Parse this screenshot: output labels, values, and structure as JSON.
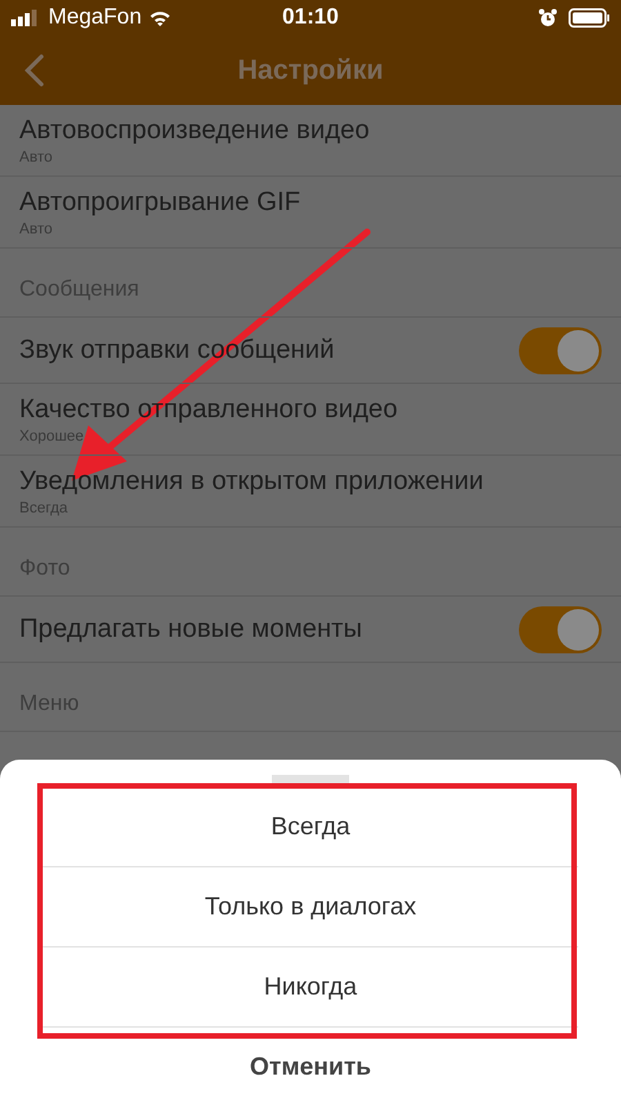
{
  "status_bar": {
    "carrier": "MegaFon",
    "time": "01:10"
  },
  "nav": {
    "title": "Настройки"
  },
  "settings": [
    {
      "kind": "value",
      "title": "Автовоспроизведение видео",
      "value": "Авто"
    },
    {
      "kind": "value",
      "title": "Автопроигрывание GIF",
      "value": "Авто"
    },
    {
      "kind": "header",
      "title": "Сообщения"
    },
    {
      "kind": "toggle",
      "title": "Звук отправки сообщений",
      "on": true
    },
    {
      "kind": "value",
      "title": "Качество отправленного видео",
      "value": "Хорошее"
    },
    {
      "kind": "value",
      "title": "Уведомления в открытом приложении",
      "value": "Всегда"
    },
    {
      "kind": "header",
      "title": "Фото"
    },
    {
      "kind": "toggle",
      "title": "Предлагать новые моменты",
      "on": true
    },
    {
      "kind": "header",
      "title": "Меню"
    }
  ],
  "sheet": {
    "options": [
      "Всегда",
      "Только в диалогах",
      "Никогда"
    ],
    "cancel": "Отменить"
  }
}
